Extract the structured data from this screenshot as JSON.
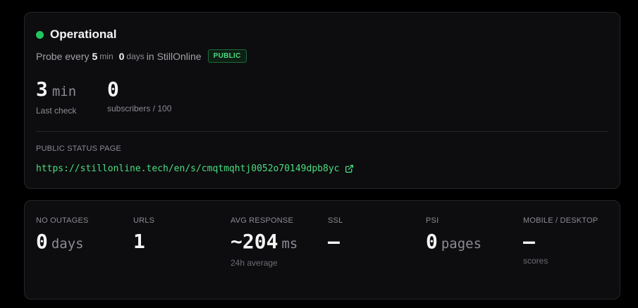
{
  "status": {
    "title": "Operational",
    "indicator_color": "#22c55e",
    "probe_prefix": "Probe every",
    "probe_interval": "5",
    "probe_interval_unit": "min",
    "days_value": "0",
    "days_unit": "days",
    "in_text": "in StillOnline",
    "badge": "PUBLIC",
    "last_check": {
      "value": "3",
      "unit": "min",
      "label": "Last check"
    },
    "subscribers": {
      "value": "0",
      "label": "subscribers / 100"
    },
    "section_label": "PUBLIC STATUS PAGE",
    "public_url": "https://stillonline.tech/en/s/cmqtmqhtj0052o70149dpb8yc",
    "link_icon": "external-link-icon"
  },
  "stats": [
    {
      "header": "NO OUTAGES",
      "value": "0",
      "unit": "days",
      "sub": ""
    },
    {
      "header": "URLS",
      "value": "1",
      "unit": "",
      "sub": ""
    },
    {
      "header": "AVG RESPONSE",
      "value": "~204",
      "unit": "ms",
      "sub": "24h average"
    },
    {
      "header": "SSL",
      "value": "—",
      "unit": "",
      "sub": ""
    },
    {
      "header": "PSI",
      "value": "0",
      "unit": "pages",
      "sub": ""
    },
    {
      "header": "MOBILE / DESKTOP",
      "value": "—",
      "unit": "",
      "sub": "scores"
    }
  ]
}
